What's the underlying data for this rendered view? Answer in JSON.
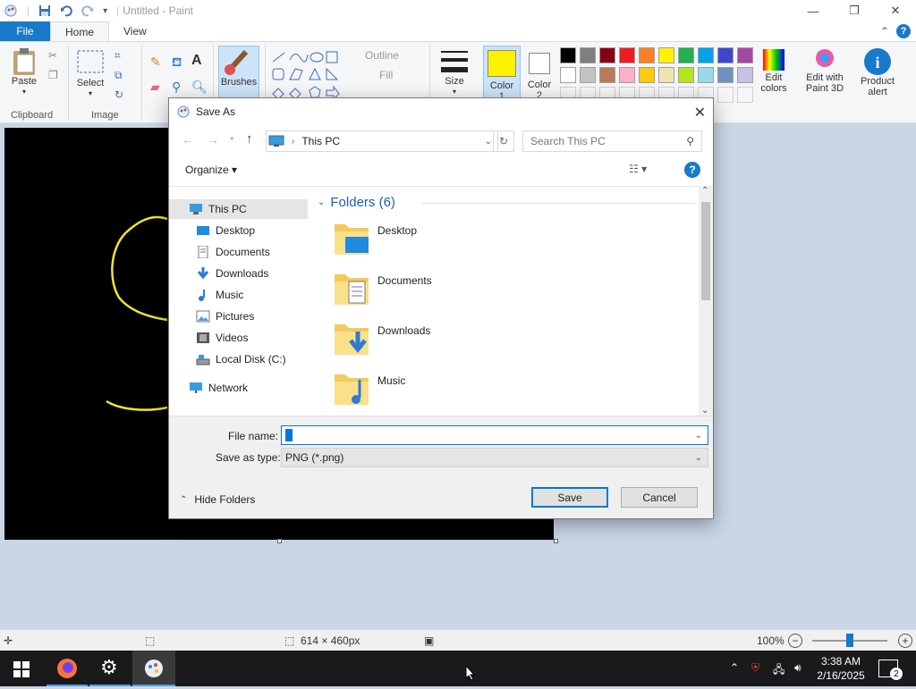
{
  "window": {
    "title": "Untitled - Paint",
    "min": "—",
    "max": "❐",
    "close": "✕"
  },
  "tabs": {
    "file": "File",
    "home": "Home",
    "view": "View",
    "help": "?"
  },
  "ribbon": {
    "clipboard": {
      "paste": "Paste",
      "label": "Clipboard"
    },
    "image": {
      "select": "Select",
      "label": "Image"
    },
    "brushes": "Brushes",
    "shapes": {
      "outline": "Outline",
      "fill": "Fill"
    },
    "size": "Size",
    "color1": "Color\n1",
    "color2": "Color\n2",
    "edit_colors": "Edit\ncolors",
    "paint3d": "Edit with\nPaint 3D",
    "product_alert": "Product\nalert",
    "colors": {
      "color1": "#fff200",
      "color2": "#ffffff",
      "row1": [
        "#000000",
        "#7f7f7f",
        "#880015",
        "#ed1c24",
        "#ff7f27",
        "#fff200",
        "#22b14c",
        "#00a2e8",
        "#3f48cc",
        "#a349a4"
      ],
      "row2": [
        "#ffffff",
        "#c3c3c3",
        "#b97a57",
        "#ffaec9",
        "#ffc90e",
        "#efe4b0",
        "#b5e61d",
        "#99d9ea",
        "#7092be",
        "#c8bfe7"
      ]
    }
  },
  "dialog": {
    "title": "Save As",
    "address": "This PC",
    "search_placeholder": "Search This PC",
    "organize": "Organize ▾",
    "nav": [
      {
        "label": "This PC",
        "icon": "pc"
      },
      {
        "label": "Desktop",
        "icon": "desktop"
      },
      {
        "label": "Documents",
        "icon": "documents"
      },
      {
        "label": "Downloads",
        "icon": "downloads"
      },
      {
        "label": "Music",
        "icon": "music"
      },
      {
        "label": "Pictures",
        "icon": "pictures"
      },
      {
        "label": "Videos",
        "icon": "videos"
      },
      {
        "label": "Local Disk (C:)",
        "icon": "disk"
      },
      {
        "label": "Network",
        "icon": "network"
      }
    ],
    "folders_header": "Folders (6)",
    "folders": [
      "Desktop",
      "Documents",
      "Downloads",
      "Music"
    ],
    "file_name_label": "File name:",
    "file_name_value": "",
    "save_type_label": "Save as type:",
    "save_type_value": "PNG (*.png)",
    "hide_folders": "Hide Folders",
    "save": "Save",
    "cancel": "Cancel"
  },
  "status": {
    "dimensions": "614 × 460px",
    "zoom": "100%",
    "zoom_percent": 100
  },
  "taskbar": {
    "time": "3:38 AM",
    "date": "2/16/2025",
    "notifications": "2"
  }
}
